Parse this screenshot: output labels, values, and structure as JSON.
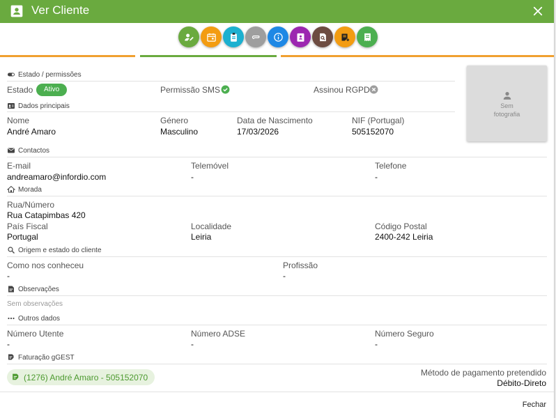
{
  "window": {
    "title": "Ver Cliente"
  },
  "toolbar": {
    "buttons": [
      {
        "icon": "edit-user-icon",
        "color": "#6aaa3f"
      },
      {
        "icon": "calendar-icon",
        "color": "#f39c12"
      },
      {
        "icon": "clipboard-icon",
        "color": "#1cb0d0"
      },
      {
        "icon": "attachment-icon",
        "color": "#9e9e9e"
      },
      {
        "icon": "info-icon",
        "color": "#1e88e5"
      },
      {
        "icon": "contact-card-icon",
        "color": "#9c27b0"
      },
      {
        "icon": "document-search-icon",
        "color": "#6d4c41"
      },
      {
        "icon": "note-add-icon",
        "color": "#f39c12"
      },
      {
        "icon": "receipt-icon",
        "color": "#4caf50"
      }
    ],
    "accent_orange": "#f0a030",
    "accent_green": "#6aaa3f"
  },
  "estado": {
    "section_label": "Estado / permissões",
    "estado_label": "Estado",
    "estado_value": "Ativo",
    "sms_label": "Permissão SMS",
    "rgpd_label": "Assinou RGPD"
  },
  "photo": {
    "text": "Sem\nfotografia"
  },
  "dados": {
    "section_label": "Dados principais",
    "nome_label": "Nome",
    "nome_value": "André Amaro",
    "genero_label": "Género",
    "genero_value": "Masculino",
    "nascimento_label": "Data de Nascimento",
    "nascimento_value": "17/03/2026",
    "nif_label": "NIF (Portugal)",
    "nif_value": "505152070"
  },
  "contactos": {
    "section_label": "Contactos",
    "email_label": "E-mail",
    "email_value": "andreamaro@infordio.com",
    "telemovel_label": "Telemóvel",
    "telemovel_value": "-",
    "telefone_label": "Telefone",
    "telefone_value": "-"
  },
  "morada": {
    "section_label": "Morada",
    "rua_label": "Rua/Número",
    "rua_value": "Rua Catapimbas 420",
    "pais_label": "País Fiscal",
    "pais_value": "Portugal",
    "localidade_label": "Localidade",
    "localidade_value": "Leiria",
    "cp_label": "Código Postal",
    "cp_value": "2400-242 Leiria"
  },
  "origem": {
    "section_label": "Origem e estado do cliente",
    "conheceu_label": "Como nos conheceu",
    "conheceu_value": "-",
    "profissao_label": "Profissão",
    "profissao_value": "-"
  },
  "observacoes": {
    "section_label": "Observações",
    "empty_text": "Sem observações"
  },
  "outros": {
    "section_label": "Outros dados",
    "utente_label": "Número Utente",
    "utente_value": "-",
    "adse_label": "Número ADSE",
    "adse_value": "-",
    "seguro_label": "Número Seguro",
    "seguro_value": "-"
  },
  "faturacao": {
    "section_label": "Faturação gGEST",
    "chip_text": "(1276) André Amaro - 505152070",
    "metodo_label": "Método de pagamento pretendido",
    "metodo_value": "Débito-Direto"
  },
  "footer": {
    "close_label": "Fechar"
  }
}
